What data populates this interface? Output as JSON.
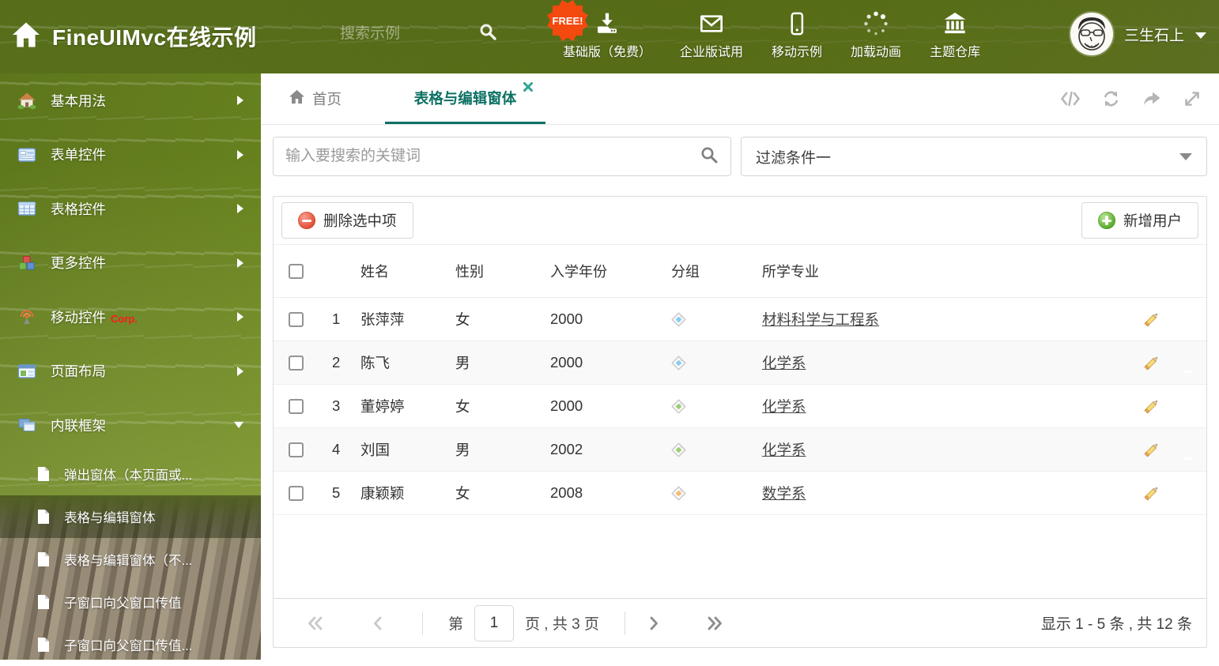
{
  "colors": {
    "accent_teal": "#0d7164",
    "close_teal": "#2fa493",
    "badge_orange": "#f4490f",
    "delete_red": "#e04a31",
    "add_green": "#55a527",
    "corp_red": "#ff1a1a"
  },
  "header": {
    "title": "FineUIMvc在线示例",
    "search_placeholder": "搜索示例",
    "free_badge": "FREE!",
    "nav_items": [
      {
        "label": "基础版（免费）",
        "icon": "download-icon"
      },
      {
        "label": "企业版试用",
        "icon": "envelope-icon"
      },
      {
        "label": "移动示例",
        "icon": "mobile-icon"
      },
      {
        "label": "加载动画",
        "icon": "spinner-icon"
      },
      {
        "label": "主题仓库",
        "icon": "bank-icon"
      }
    ],
    "username": "三生石上"
  },
  "sidebar": {
    "items": [
      {
        "label": "基本用法",
        "icon": "home-icon"
      },
      {
        "label": "表单控件",
        "icon": "form-icon"
      },
      {
        "label": "表格控件",
        "icon": "table-icon"
      },
      {
        "label": "更多控件",
        "icon": "cubes-icon"
      },
      {
        "label": "移动控件",
        "badge": "Corp.",
        "icon": "antenna-icon"
      },
      {
        "label": "页面布局",
        "icon": "layout-icon"
      },
      {
        "label": "内联框架",
        "icon": "frames-icon",
        "expanded": true
      }
    ],
    "subitems": [
      {
        "label": "弹出窗体（本页面或..."
      },
      {
        "label": "表格与编辑窗体",
        "selected": true
      },
      {
        "label": "表格与编辑窗体（不..."
      },
      {
        "label": "子窗口向父窗口传值"
      },
      {
        "label": "子窗口向父窗口传值..."
      }
    ]
  },
  "tabs": {
    "home_label": "首页",
    "active_label": "表格与编辑窗体"
  },
  "filters": {
    "search_placeholder": "输入要搜索的关键词",
    "filter_value": "过滤条件一"
  },
  "toolbar": {
    "delete_label": "删除选中项",
    "add_label": "新增用户"
  },
  "table": {
    "headers": [
      "姓名",
      "性别",
      "入学年份",
      "分组",
      "所学专业"
    ],
    "rows": [
      {
        "num": "1",
        "name": "张萍萍",
        "gender": "女",
        "year": "2000",
        "tag_color": "#85ccf3",
        "major": "材料科学与工程系"
      },
      {
        "num": "2",
        "name": "陈飞",
        "gender": "男",
        "year": "2000",
        "tag_color": "#85ccf3",
        "major": "化学系"
      },
      {
        "num": "3",
        "name": "董婷婷",
        "gender": "女",
        "year": "2000",
        "tag_color": "#99cf70",
        "major": "化学系"
      },
      {
        "num": "4",
        "name": "刘国",
        "gender": "男",
        "year": "2002",
        "tag_color": "#99cf70",
        "major": "化学系"
      },
      {
        "num": "5",
        "name": "康颖颖",
        "gender": "女",
        "year": "2008",
        "tag_color": "#f7b872",
        "major": "数学系"
      }
    ]
  },
  "pagination": {
    "prefix": "第",
    "page": "1",
    "suffix": "页 , 共 3 页",
    "info": "显示 1 - 5 条 , 共 12 条"
  }
}
